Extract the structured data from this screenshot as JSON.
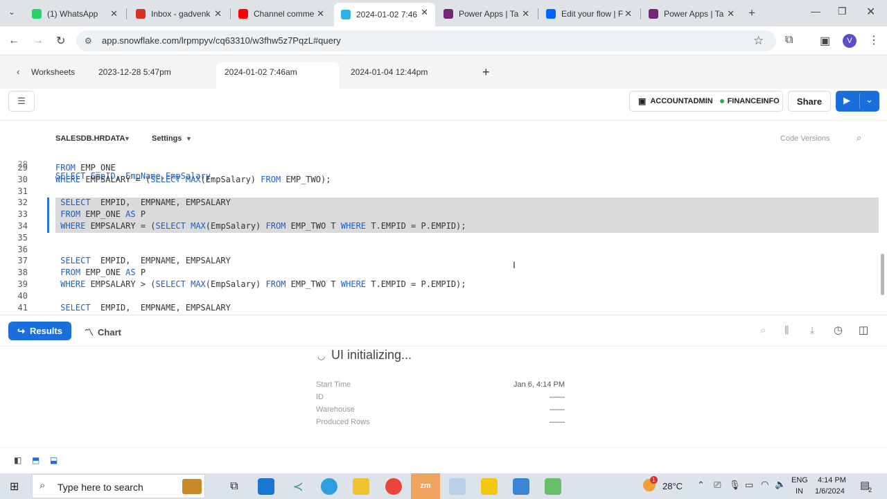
{
  "browser": {
    "tabs": [
      {
        "label": "(1) WhatsApp",
        "color": "#25d366"
      },
      {
        "label": "Inbox - gadvenk",
        "color": "#d93025"
      },
      {
        "label": "Channel comme",
        "color": "#ff0000"
      },
      {
        "label": "2024-01-02 7:46",
        "color": "#29b5e8"
      },
      {
        "label": "Power Apps | Ta",
        "color": "#742774"
      },
      {
        "label": "Edit your flow | F",
        "color": "#0066ff"
      },
      {
        "label": "Power Apps | Ta",
        "color": "#742774"
      }
    ],
    "url": "app.snowflake.com/lrpmpyv/cq63310/w3fhw5z7PqzL#query",
    "profile_initial": "V"
  },
  "worksheets": {
    "back_label": "Worksheets",
    "tabs": [
      "2023-12-28 5:47pm",
      "2024-01-02 7:46am",
      "2024-01-04 12:44pm"
    ],
    "add_label": "+"
  },
  "toolbar": {
    "role": "ACCOUNTADMIN",
    "warehouse": "FINANCEINFO",
    "share_label": "Share"
  },
  "context": {
    "database": "SALESDB.HRDATA",
    "settings": "Settings",
    "code_versions": "Code Versions"
  },
  "editor": {
    "partial_top": "SELECT EmpID, EmpName,EmpSalary",
    "lines": [
      {
        "n": "29",
        "tokens": [
          [
            "FROM",
            "kw"
          ],
          [
            " EMP_ONE",
            ""
          ]
        ]
      },
      {
        "n": "30",
        "tokens": [
          [
            "WHERE",
            "kw"
          ],
          [
            " EMPSALARY = (",
            ""
          ],
          [
            "SELECT",
            "kw"
          ],
          [
            " ",
            ""
          ],
          [
            "MAX",
            "kw"
          ],
          [
            "(EmpSalary) ",
            ""
          ],
          [
            "FROM",
            "kw"
          ],
          [
            " EMP_TWO);",
            ""
          ]
        ]
      },
      {
        "n": "31",
        "tokens": []
      },
      {
        "n": "32",
        "tokens": [
          [
            " ",
            ""
          ],
          [
            "SELECT",
            "kw"
          ],
          [
            "  EMPID,  EMPNAME, EMPSALARY",
            ""
          ]
        ]
      },
      {
        "n": "33",
        "tokens": [
          [
            " ",
            ""
          ],
          [
            "FROM",
            "kw"
          ],
          [
            " EMP_ONE ",
            ""
          ],
          [
            "AS",
            "kw"
          ],
          [
            " P",
            ""
          ]
        ]
      },
      {
        "n": "34",
        "tokens": [
          [
            " ",
            ""
          ],
          [
            "WHERE",
            "kw"
          ],
          [
            " EMPSALARY = (",
            ""
          ],
          [
            "SELECT",
            "kw"
          ],
          [
            " ",
            ""
          ],
          [
            "MAX",
            "kw"
          ],
          [
            "(EmpSalary) ",
            ""
          ],
          [
            "FROM",
            "kw"
          ],
          [
            " EMP_TWO T ",
            ""
          ],
          [
            "WHERE",
            "kw"
          ],
          [
            " T.EMPID = P.EMPID);",
            ""
          ]
        ]
      },
      {
        "n": "35",
        "tokens": []
      },
      {
        "n": "36",
        "tokens": []
      },
      {
        "n": "37",
        "tokens": [
          [
            " ",
            ""
          ],
          [
            "SELECT",
            "kw"
          ],
          [
            "  EMPID,  EMPNAME, EMPSALARY",
            ""
          ]
        ]
      },
      {
        "n": "38",
        "tokens": [
          [
            " ",
            ""
          ],
          [
            "FROM",
            "kw"
          ],
          [
            " EMP_ONE ",
            ""
          ],
          [
            "AS",
            "kw"
          ],
          [
            " P",
            ""
          ]
        ]
      },
      {
        "n": "39",
        "tokens": [
          [
            " ",
            ""
          ],
          [
            "WHERE",
            "kw"
          ],
          [
            " EMPSALARY > (",
            ""
          ],
          [
            "SELECT",
            "kw"
          ],
          [
            " ",
            ""
          ],
          [
            "MAX",
            "kw"
          ],
          [
            "(EmpSalary) ",
            ""
          ],
          [
            "FROM",
            "kw"
          ],
          [
            " EMP_TWO T ",
            ""
          ],
          [
            "WHERE",
            "kw"
          ],
          [
            " T.EMPID = P.EMPID);",
            ""
          ]
        ]
      },
      {
        "n": "40",
        "tokens": []
      },
      {
        "n": "41",
        "tokens": [
          [
            " ",
            ""
          ],
          [
            "SELECT",
            "kw"
          ],
          [
            "  EMPID,  EMPNAME, EMPSALARY",
            ""
          ]
        ]
      }
    ]
  },
  "results": {
    "results_label": "Results",
    "chart_label": "Chart",
    "initializing": "UI initializing...",
    "rows": [
      {
        "label": "Start Time",
        "value": "Jan 6, 4:14 PM"
      },
      {
        "label": "ID",
        "value": "——"
      },
      {
        "label": "Warehouse",
        "value": "——"
      },
      {
        "label": "Produced Rows",
        "value": "——"
      }
    ]
  },
  "taskbar": {
    "search_placeholder": "Type here to search",
    "weather_temp": "28°C",
    "weather_badge": "1",
    "lang_top": "ENG",
    "lang_bottom": "IN",
    "time": "4:14 PM",
    "date": "1/6/2024",
    "notifications": "2"
  }
}
